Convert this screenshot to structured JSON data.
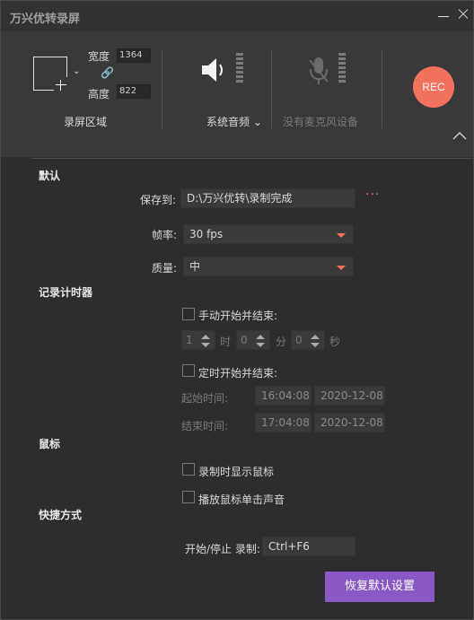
{
  "app": {
    "title": "万兴优转录屏"
  },
  "toolbar": {
    "width_label": "宽度",
    "width_value": "1364",
    "height_label": "高度",
    "height_value": "822",
    "region_caption": "录屏区域",
    "audio_caption": "系统音频",
    "mic_caption": "没有麦克风设备",
    "rec_label": "REC"
  },
  "default_section": {
    "title": "默认",
    "save_label": "保存到:",
    "save_value": "D:\\万兴优转\\录制完成",
    "more_label": "···",
    "fps_label": "帧率:",
    "fps_value": "30 fps",
    "quality_label": "质量:",
    "quality_value": "中"
  },
  "timer_section": {
    "title": "记录计时器",
    "manual_label": "手动开始并结束:",
    "hours_value": "1",
    "hours_unit": "时",
    "minutes_value": "0",
    "minutes_unit": "分",
    "seconds_value": "0",
    "seconds_unit": "秒",
    "scheduled_label": "定时开始并结束:",
    "start_label": "起始时间:",
    "start_time": "16:04:08",
    "start_date": "2020-12-08",
    "end_label": "结束时间:",
    "end_time": "17:04:08",
    "end_date": "2020-12-08"
  },
  "mouse_section": {
    "title": "鼠标",
    "show_cursor_label": "录制时显示鼠标",
    "click_sound_label": "播放鼠标单击声音"
  },
  "shortcut_section": {
    "title": "快捷方式",
    "start_stop_label": "开始/停止 录制:",
    "start_stop_value": "Ctrl+F6"
  },
  "footer": {
    "restore_label": "恢复默认设置"
  },
  "colors": {
    "accent": "#f2725e",
    "button": "#8859c4",
    "background": "#2e2d2d"
  }
}
